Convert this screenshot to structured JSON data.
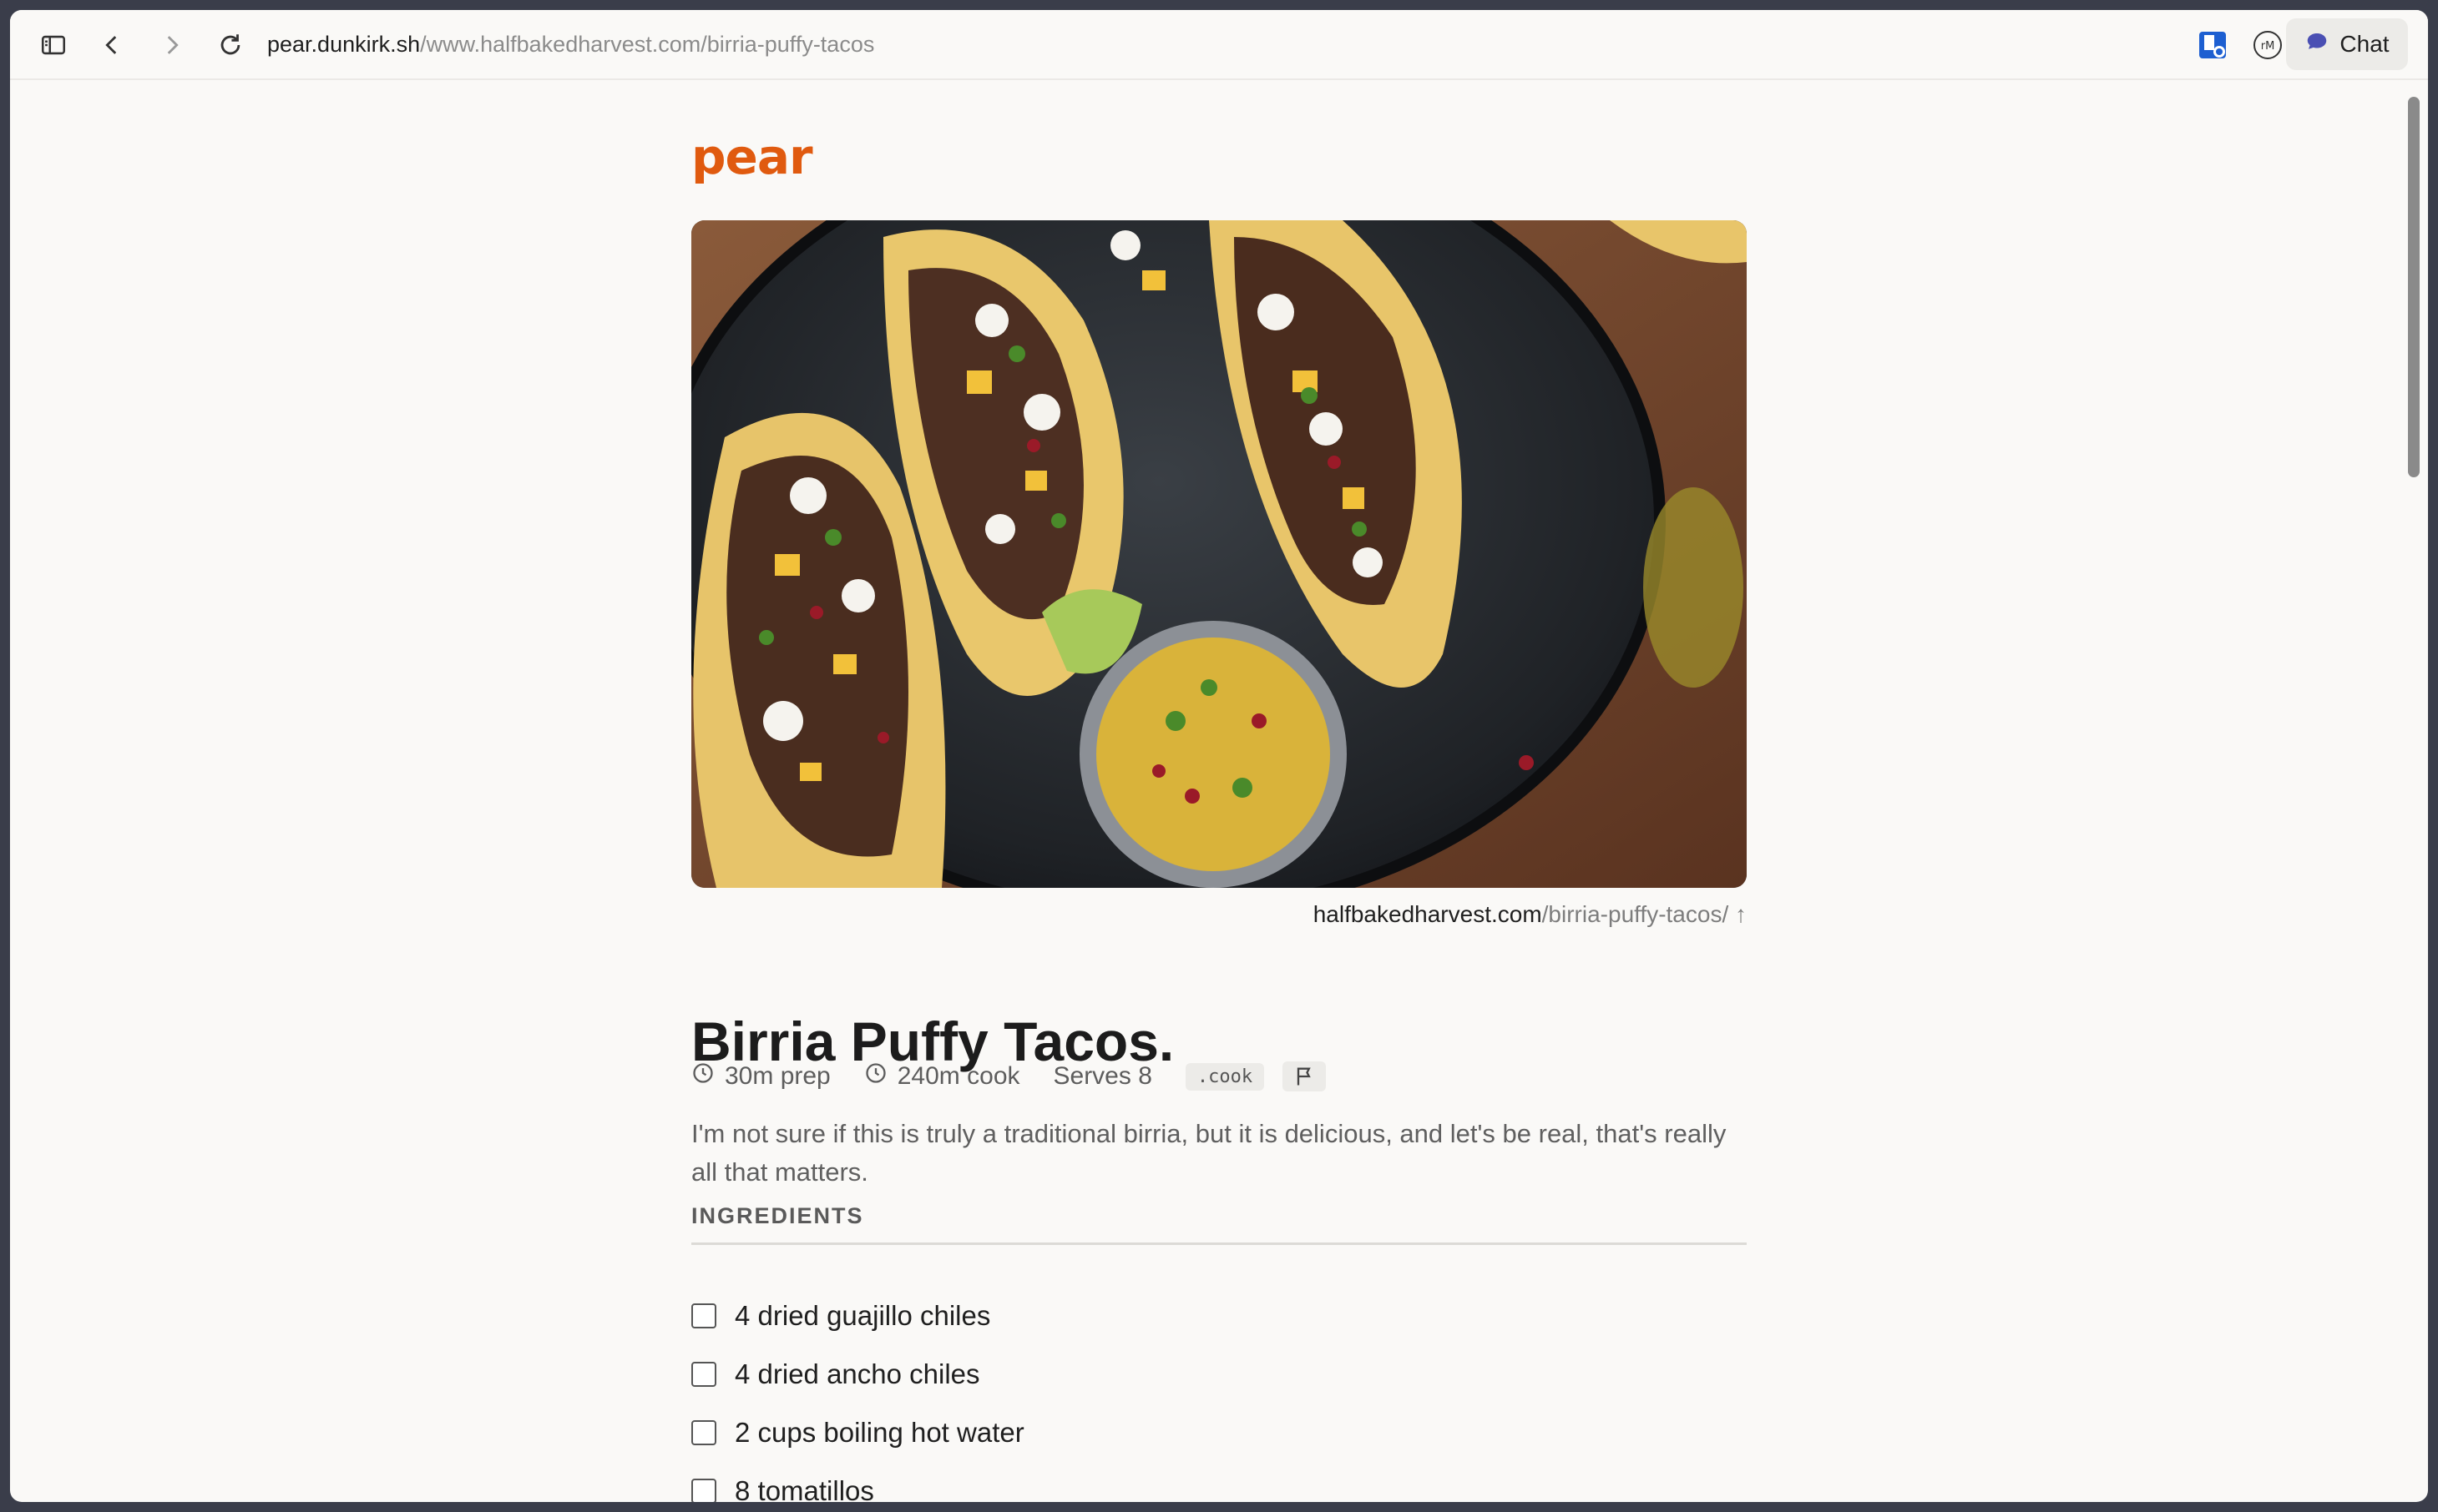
{
  "browser": {
    "url_host": "pear.dunkirk.sh",
    "url_path": "/www.halfbakedharvest.com/birria-puffy-tacos",
    "chat_label": "Chat",
    "icons": [
      "sidebar-toggle-icon",
      "back-icon",
      "forward-icon",
      "reload-icon"
    ]
  },
  "site": {
    "logo": "pear"
  },
  "recipe": {
    "source_host": "halfbakedharvest.com",
    "source_path": "/birria-puffy-tacos/",
    "source_arrow": "↑",
    "title": "Birria Puffy Tacos.",
    "prep": "30m prep",
    "cook": "240m cook",
    "serves": "Serves 8",
    "cook_tag": ".cook",
    "description": " I'm not sure if this is truly a traditional birria, but it is delicious, and let's be real, that's really all that matters.",
    "ingredients_heading": "INGREDIENTS",
    "ingredients": [
      "4 dried guajillo chiles",
      "4 dried ancho chiles",
      "2 cups boiling hot water",
      "8 tomatillos"
    ]
  },
  "colors": {
    "brand": "#e05a0f",
    "chat_icon": "#4a4fb3"
  }
}
